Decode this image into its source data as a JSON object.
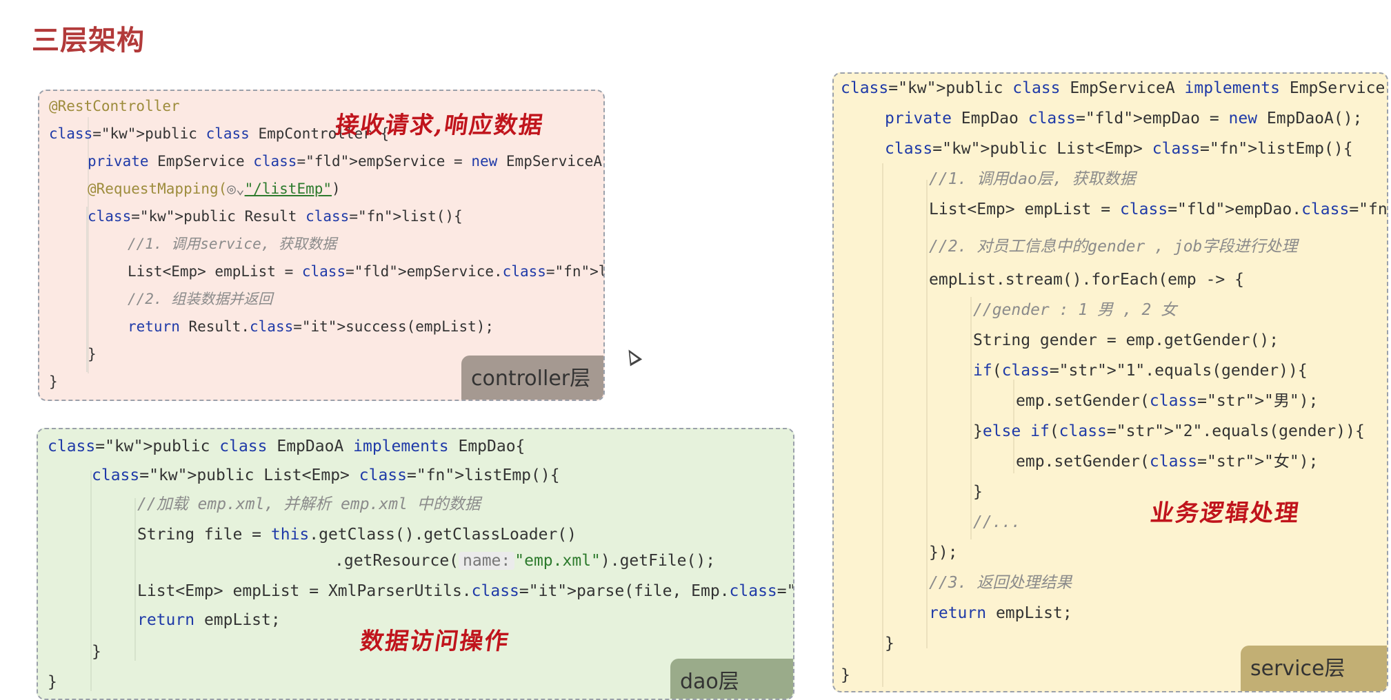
{
  "title": "三层架构",
  "controller": {
    "tag": "controller层",
    "note": "接收请求,响应数据",
    "lines": [
      "@RestController",
      "public class EmpController {",
      "private EmpService empService = new EmpServiceA();",
      "@RequestMapping(",
      "\"/listEmp\"",
      ")",
      "public Result list(){",
      "//1. 调用service, 获取数据",
      "List<Emp> empList = empService.listEmp();",
      "//2. 组装数据并返回",
      "return Result.success(empList);",
      "}",
      "}"
    ]
  },
  "dao": {
    "tag": "dao层",
    "note": "数据访问操作",
    "param_hint": "name:",
    "lines": [
      "public class EmpDaoA implements EmpDao{",
      "public List<Emp> listEmp(){",
      "//加载 emp.xml, 并解析 emp.xml 中的数据",
      "String file = this.getClass().getClassLoader()",
      ".getResource(",
      "\"emp.xml\"",
      ").getFile();",
      "List<Emp> empList = XmlParserUtils.parse(file, Emp.class);",
      "return empList;",
      "}",
      "}"
    ]
  },
  "service": {
    "tag": "service层",
    "note": "业务逻辑处理",
    "lines": [
      "public class EmpServiceA implements EmpService{",
      "private EmpDao empDao = new EmpDaoA();",
      "public List<Emp> listEmp(){",
      "//1. 调用dao层, 获取数据",
      "List<Emp> empList = empDao.listEmp();",
      "//2. 对员工信息中的gender , job字段进行处理",
      "empList.stream().forEach(emp -> {",
      "//gender : 1 男 , 2 女",
      "String gender = emp.getGender();",
      "if(\"1\".equals(gender)){",
      "emp.setGender(\"男\");",
      "}else if(\"2\".equals(gender)){",
      "emp.setGender(\"女\");",
      "}",
      "//...",
      "});",
      "//3. 返回处理结果",
      "return empList;",
      "}",
      "}"
    ]
  }
}
